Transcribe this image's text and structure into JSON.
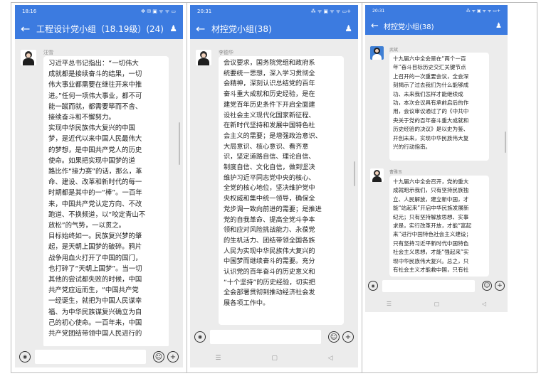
{
  "panel1": {
    "status": {
      "time": "18:16",
      "icons": "✻ ✉ ▣ ᯤ ᯤ ▭"
    },
    "title": "工程设计党小组（18.19级）(24)",
    "sender": "汪雪",
    "message": "习近平总书记指出：“一切伟大\n成就都是接续奋斗的结果，一切\n伟大事业都需要在继往开来中推\n进。”任何一项伟大事业，都不可\n能一蹴而就，都需要筚而不舍、\n接续奋斗和不懈努力。\n实现中华民族伟大复兴的中国\n梦，是近代以来中国人民最伟大\n的梦想，是中国共产党人的历史\n使命。如果把实现中国梦的道\n路比作“接力赛”的话，那么，革\n命、建设、改革和新时代的每一\n时期都是其中的一“棒”。一百年\n来，中国共产党认定方向、不改\n跑道、不换频道，以“咬定青山不\n放松”的气势，一以贯之。\n目标始终如一。民族复兴梦的肇\n起，是天朝上国梦的破碎。鸦片\n战争用血火打开了中国的国门，\n也打碎了“天朝上国梦”。当一切\n其他的尝试都失败的时候，中国\n共产党应运而生，“中国共产党\n一经诞生，就把为中国人民谋幸\n福、为中华民族谋复兴确立为自\n己的初心使命。一百年来，中国\n共产党团结带领中国人民进行的"
  },
  "panel2": {
    "status": {
      "time": "20:31",
      "icons": "⁂ ᯤ ▣ ᯤ ᯤ ▭+"
    },
    "title": "材控党小组(38)",
    "sender": "李德华",
    "message": "会议要求，国务院党组和政府系\n统要统一思想，深入学习贯彻全\n会精神，深刻认识总结党的百年\n奋斗重大成就和历史经验，是在\n建党百年历史条件下开启全面建\n设社会主义现代化国家新征程、\n在新时代坚持和发展中国特色社\n会主义的需要；是增强政治意识、\n大局意识、核心意识、看齐意\n识，坚定道路自信、理论自信、\n制度自信、文化自信，做到坚决\n维护习近平同志党中央的核心、\n全党的核心地位，坚决维护党中\n央权威和集中统一领导，确保全\n党步调一致向前进的需要；是推进\n党的自我革命、提高全党斗争本\n领和应对风险挑战能力、永葆党\n的生机活力、团结带领全国各族\n人民为实现中华民族伟大复兴的\n中国梦而继续奋斗的需要。充分\n认识党的百年奋斗的历史意义和\n“十个坚持”的历史经验，切实把\n全会部署贯彻到推动经济社会发\n展各项工作中。"
  },
  "panel3": {
    "status": {
      "time": "20:31",
      "icons": "⁂ ᯤ ▣ ᯤ ᯤ ▭+"
    },
    "title": "材控党小组(38)",
    "sender1": "武斌",
    "message1": "十九届六中全会是在“两个一百\n年”奋斗目标历史交汇关键节点\n上召开的一次重要会议，全会深\n刻揭示了过去我们为什么能够成\n功、未来我们怎样才能继续成\n功，本次会议具有承前启后的作\n用，会议审议通过了的《中共中\n央关于党的百年奋斗重大成就和\n历史经验的决议》是以史为鉴、\n开创未来，实现中华民族伟大复\n兴的行动指南。",
    "sender2": "曹雅玉",
    "message2": "十九届六中全会召开，党的重大\n成就昭示我们，只有坚持民族独\n立、人民解放，建立新中国，才\n能“站起来”开启中华民族发展新\n纪元；只有坚持解放思想、实事\n求是，实行改革开放，才能“富起\n来”进行中国特色社会主义建设；\n只有坚持习近平新时代中国特色\n社会主义思想，才能“强起来”实\n现中华民族伟大复兴。总之，只\n有社会主义才能救中国，只有社"
  },
  "icons": {
    "back": "arrow-left-icon",
    "people": "group-icon",
    "voice": "voice-icon",
    "emoji": "emoji-icon",
    "plus": "plus-icon",
    "nav_menu": "menu-icon",
    "nav_home": "home-icon",
    "nav_back": "back-triangle-icon"
  }
}
